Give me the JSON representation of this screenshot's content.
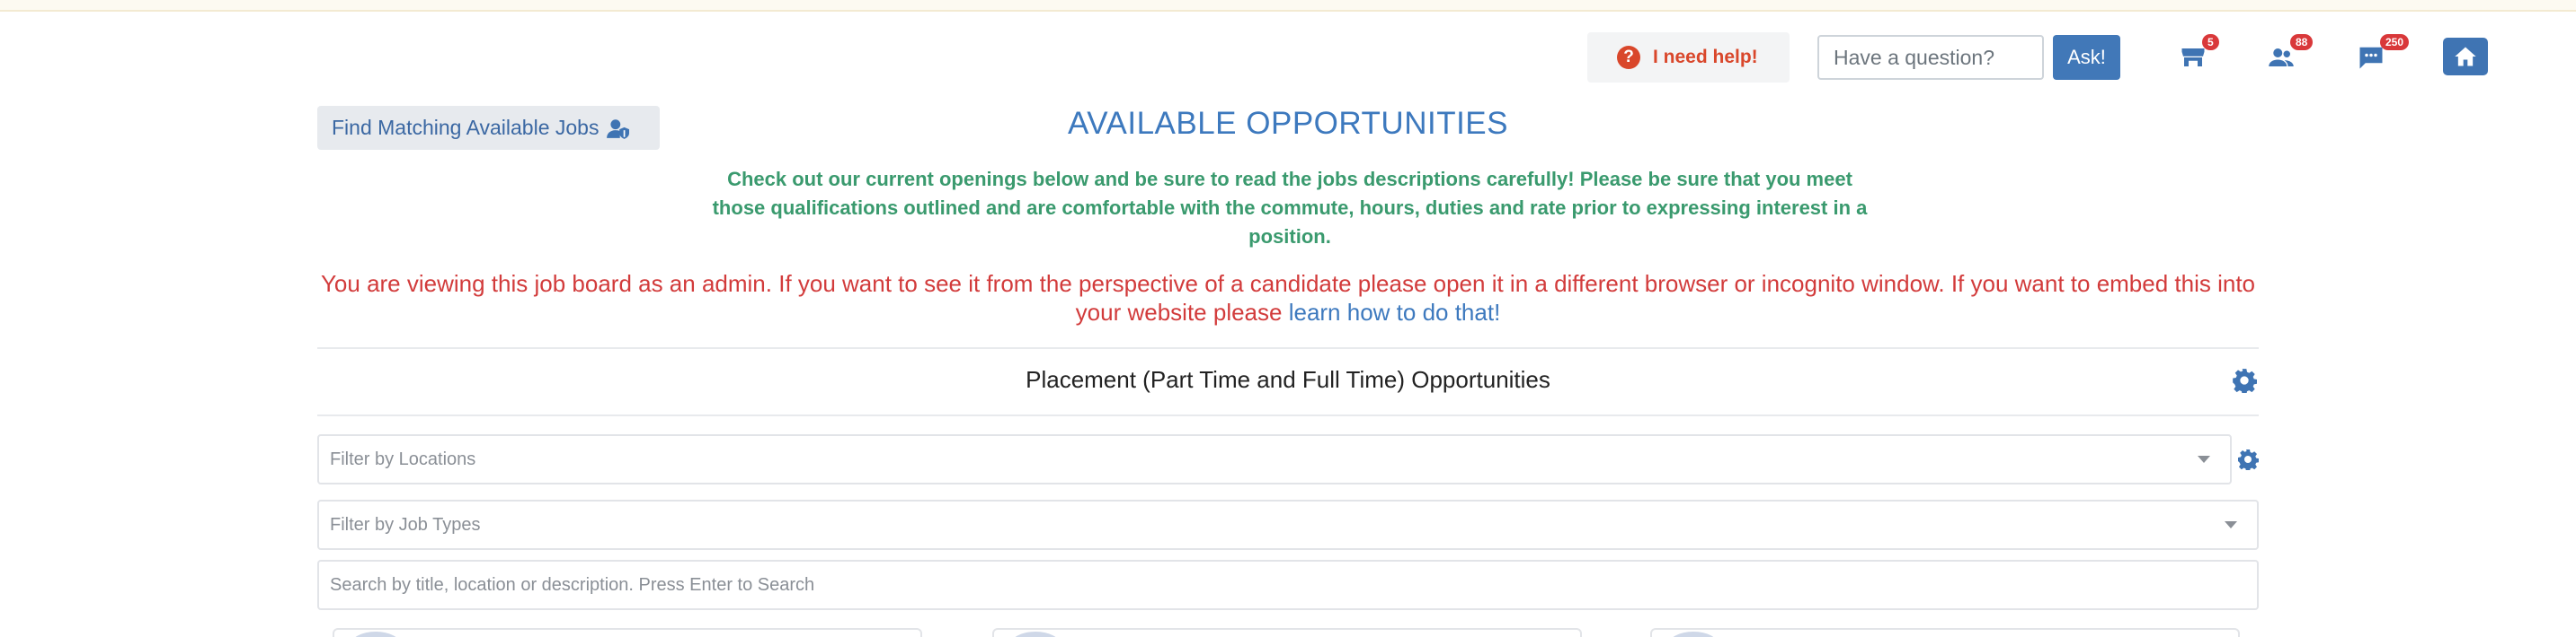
{
  "header": {
    "help_label": "I need help!",
    "help_icon": "question-circle-icon",
    "question_placeholder": "Have a question?",
    "ask_label": "Ask!",
    "nav": [
      {
        "name": "store-icon",
        "badge": "5"
      },
      {
        "name": "users-icon",
        "badge": "88"
      },
      {
        "name": "messages-icon",
        "badge": "250"
      },
      {
        "name": "home-icon"
      }
    ]
  },
  "main": {
    "find_jobs_label": "Find Matching Available Jobs",
    "title": "AVAILABLE OPPORTUNITIES",
    "intro": "Check out our current openings below and be sure to read the jobs descriptions carefully! Please be sure that you meet those qualifications outlined and are comfortable with the commute, hours, duties and rate prior to expressing interest in a position.",
    "admin_note": "You are viewing this job board as an admin. If you want to see it from the perspective of a candidate please open it in a different browser or incognito window. If you want to embed this into your website please ",
    "admin_link": "learn how to do that!",
    "section_title": "Placement (Part Time and Full Time) Opportunities",
    "filter_locations_placeholder": "Filter by Locations",
    "filter_job_types_placeholder": "Filter by Job Types",
    "search_placeholder": "Search by title, location or description. Press Enter to Search"
  },
  "colors": {
    "accent": "#3f74b3",
    "title": "#3d79be",
    "intro": "#3a9a6e",
    "warning": "#d23b3b",
    "help": "#d9472b",
    "badge": "#d9383a"
  }
}
